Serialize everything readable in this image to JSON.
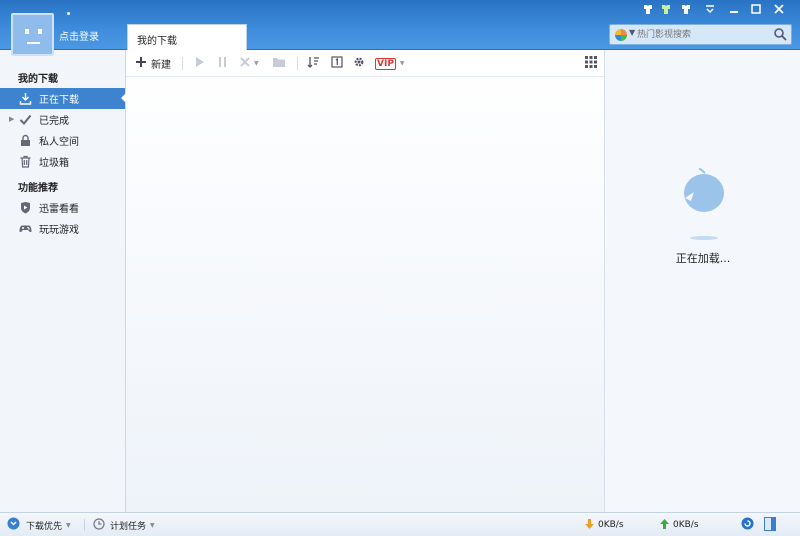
{
  "header": {
    "login_label": "点击登录",
    "tab_label": "我的下载",
    "search_placeholder": "热门影视搜索",
    "window_controls": [
      "skin-icon",
      "skin-icon",
      "skin-icon",
      "menu-icon",
      "minimize-icon",
      "maximize-icon",
      "close-icon"
    ]
  },
  "sidebar": {
    "section_downloads": "我的下载",
    "items": [
      {
        "label": "正在下载",
        "icon": "download-icon"
      },
      {
        "label": "已完成",
        "icon": "check-icon"
      },
      {
        "label": "私人空间",
        "icon": "lock-icon"
      },
      {
        "label": "垃圾箱",
        "icon": "trash-icon"
      }
    ],
    "section_features": "功能推荐",
    "features": [
      {
        "label": "迅雷看看",
        "icon": "kankan-icon"
      },
      {
        "label": "玩玩游戏",
        "icon": "gamepad-icon"
      }
    ]
  },
  "toolbar": {
    "new_label": "新建",
    "vip_label": "VIP"
  },
  "right_panel": {
    "loading_text": "正在加载..."
  },
  "statusbar": {
    "priority_label": "下载优先",
    "schedule_label": "计划任务",
    "down_speed": "0KB/s",
    "up_speed": "0KB/s"
  },
  "colors": {
    "header_blue": "#3f8ddc",
    "active_item": "#3d83cf",
    "vip_red": "#d33"
  }
}
